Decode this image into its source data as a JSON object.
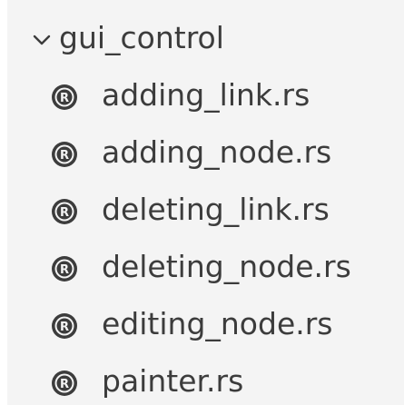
{
  "explorer": {
    "folder": {
      "label": "gui_control",
      "expanded": true,
      "icon": "chevron-down-icon"
    },
    "files": [
      {
        "label": "adding_link.rs",
        "icon": "rust-file-icon"
      },
      {
        "label": "adding_node.rs",
        "icon": "rust-file-icon"
      },
      {
        "label": "deleting_link.rs",
        "icon": "rust-file-icon"
      },
      {
        "label": "deleting_node.rs",
        "icon": "rust-file-icon"
      },
      {
        "label": "editing_node.rs",
        "icon": "rust-file-icon"
      },
      {
        "label": "painter.rs",
        "icon": "rust-file-icon"
      }
    ]
  },
  "colors": {
    "panel_background": "#f4f4f4",
    "text": "#3c3c3c",
    "icon": "#3c3c3c"
  }
}
